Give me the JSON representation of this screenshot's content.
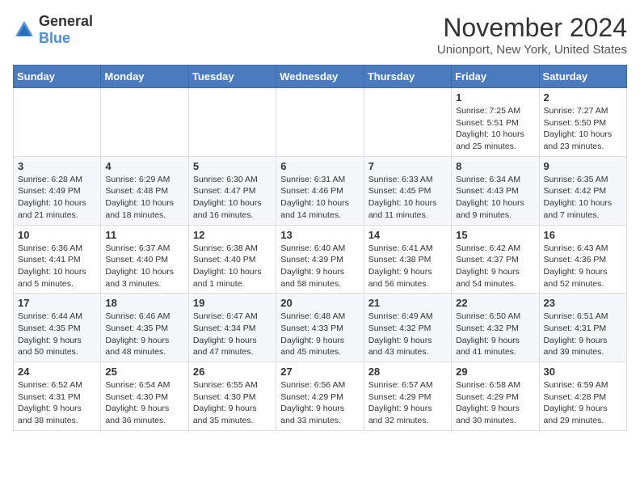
{
  "logo": {
    "general": "General",
    "blue": "Blue"
  },
  "header": {
    "month": "November 2024",
    "location": "Unionport, New York, United States"
  },
  "weekdays": [
    "Sunday",
    "Monday",
    "Tuesday",
    "Wednesday",
    "Thursday",
    "Friday",
    "Saturday"
  ],
  "weeks": [
    [
      {
        "day": "",
        "info": ""
      },
      {
        "day": "",
        "info": ""
      },
      {
        "day": "",
        "info": ""
      },
      {
        "day": "",
        "info": ""
      },
      {
        "day": "",
        "info": ""
      },
      {
        "day": "1",
        "info": "Sunrise: 7:25 AM\nSunset: 5:51 PM\nDaylight: 10 hours and 25 minutes."
      },
      {
        "day": "2",
        "info": "Sunrise: 7:27 AM\nSunset: 5:50 PM\nDaylight: 10 hours and 23 minutes."
      }
    ],
    [
      {
        "day": "3",
        "info": "Sunrise: 6:28 AM\nSunset: 4:49 PM\nDaylight: 10 hours and 21 minutes."
      },
      {
        "day": "4",
        "info": "Sunrise: 6:29 AM\nSunset: 4:48 PM\nDaylight: 10 hours and 18 minutes."
      },
      {
        "day": "5",
        "info": "Sunrise: 6:30 AM\nSunset: 4:47 PM\nDaylight: 10 hours and 16 minutes."
      },
      {
        "day": "6",
        "info": "Sunrise: 6:31 AM\nSunset: 4:46 PM\nDaylight: 10 hours and 14 minutes."
      },
      {
        "day": "7",
        "info": "Sunrise: 6:33 AM\nSunset: 4:45 PM\nDaylight: 10 hours and 11 minutes."
      },
      {
        "day": "8",
        "info": "Sunrise: 6:34 AM\nSunset: 4:43 PM\nDaylight: 10 hours and 9 minutes."
      },
      {
        "day": "9",
        "info": "Sunrise: 6:35 AM\nSunset: 4:42 PM\nDaylight: 10 hours and 7 minutes."
      }
    ],
    [
      {
        "day": "10",
        "info": "Sunrise: 6:36 AM\nSunset: 4:41 PM\nDaylight: 10 hours and 5 minutes."
      },
      {
        "day": "11",
        "info": "Sunrise: 6:37 AM\nSunset: 4:40 PM\nDaylight: 10 hours and 3 minutes."
      },
      {
        "day": "12",
        "info": "Sunrise: 6:38 AM\nSunset: 4:40 PM\nDaylight: 10 hours and 1 minute."
      },
      {
        "day": "13",
        "info": "Sunrise: 6:40 AM\nSunset: 4:39 PM\nDaylight: 9 hours and 58 minutes."
      },
      {
        "day": "14",
        "info": "Sunrise: 6:41 AM\nSunset: 4:38 PM\nDaylight: 9 hours and 56 minutes."
      },
      {
        "day": "15",
        "info": "Sunrise: 6:42 AM\nSunset: 4:37 PM\nDaylight: 9 hours and 54 minutes."
      },
      {
        "day": "16",
        "info": "Sunrise: 6:43 AM\nSunset: 4:36 PM\nDaylight: 9 hours and 52 minutes."
      }
    ],
    [
      {
        "day": "17",
        "info": "Sunrise: 6:44 AM\nSunset: 4:35 PM\nDaylight: 9 hours and 50 minutes."
      },
      {
        "day": "18",
        "info": "Sunrise: 6:46 AM\nSunset: 4:35 PM\nDaylight: 9 hours and 48 minutes."
      },
      {
        "day": "19",
        "info": "Sunrise: 6:47 AM\nSunset: 4:34 PM\nDaylight: 9 hours and 47 minutes."
      },
      {
        "day": "20",
        "info": "Sunrise: 6:48 AM\nSunset: 4:33 PM\nDaylight: 9 hours and 45 minutes."
      },
      {
        "day": "21",
        "info": "Sunrise: 6:49 AM\nSunset: 4:32 PM\nDaylight: 9 hours and 43 minutes."
      },
      {
        "day": "22",
        "info": "Sunrise: 6:50 AM\nSunset: 4:32 PM\nDaylight: 9 hours and 41 minutes."
      },
      {
        "day": "23",
        "info": "Sunrise: 6:51 AM\nSunset: 4:31 PM\nDaylight: 9 hours and 39 minutes."
      }
    ],
    [
      {
        "day": "24",
        "info": "Sunrise: 6:52 AM\nSunset: 4:31 PM\nDaylight: 9 hours and 38 minutes."
      },
      {
        "day": "25",
        "info": "Sunrise: 6:54 AM\nSunset: 4:30 PM\nDaylight: 9 hours and 36 minutes."
      },
      {
        "day": "26",
        "info": "Sunrise: 6:55 AM\nSunset: 4:30 PM\nDaylight: 9 hours and 35 minutes."
      },
      {
        "day": "27",
        "info": "Sunrise: 6:56 AM\nSunset: 4:29 PM\nDaylight: 9 hours and 33 minutes."
      },
      {
        "day": "28",
        "info": "Sunrise: 6:57 AM\nSunset: 4:29 PM\nDaylight: 9 hours and 32 minutes."
      },
      {
        "day": "29",
        "info": "Sunrise: 6:58 AM\nSunset: 4:29 PM\nDaylight: 9 hours and 30 minutes."
      },
      {
        "day": "30",
        "info": "Sunrise: 6:59 AM\nSunset: 4:28 PM\nDaylight: 9 hours and 29 minutes."
      }
    ]
  ]
}
